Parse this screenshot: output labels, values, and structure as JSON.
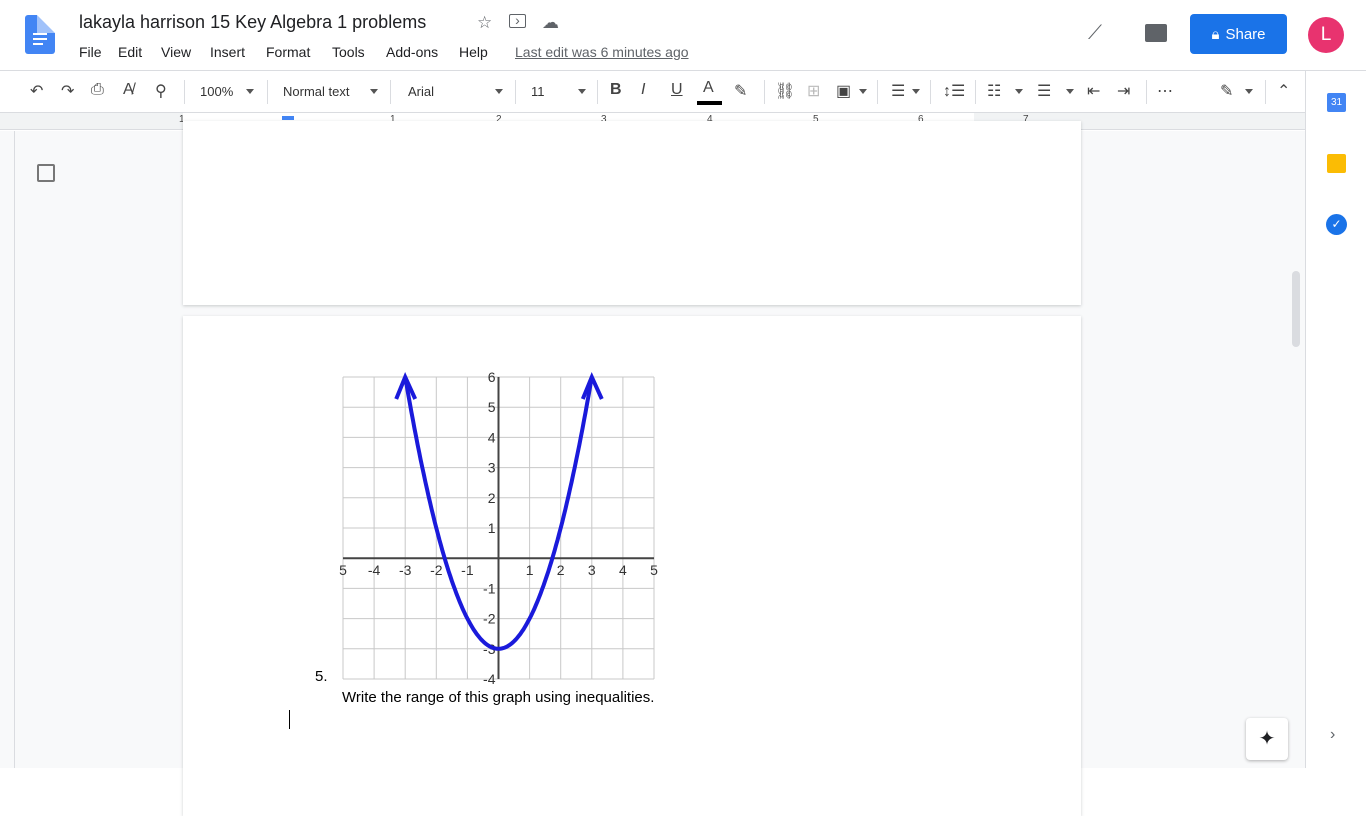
{
  "header": {
    "title": "lakayla harrison 15 Key Algebra 1 problems",
    "last_edit": "Last edit was 6 minutes ago",
    "share_label": "Share",
    "avatar_letter": "L"
  },
  "menu": [
    "File",
    "Edit",
    "View",
    "Insert",
    "Format",
    "Tools",
    "Add-ons",
    "Help"
  ],
  "toolbar": {
    "zoom": "100%",
    "style": "Normal text",
    "font": "Arial",
    "size": "11",
    "text_color": "#000000"
  },
  "ruler": {
    "labels": [
      "1",
      "1",
      "2",
      "3",
      "4",
      "5",
      "6",
      "7"
    ]
  },
  "document": {
    "list_number": "5.",
    "question": "Write the range of this graph using inequalities."
  },
  "graph": {
    "x_ticks": [
      "5",
      "-4",
      "-3",
      "-2",
      "-1",
      "1",
      "2",
      "3",
      "4",
      "5"
    ],
    "y_ticks": [
      "6",
      "5",
      "4",
      "3",
      "2",
      "1",
      "-1",
      "-2",
      "-3",
      "-4"
    ],
    "xlim": [
      -5,
      5
    ],
    "ylim": [
      -4,
      6
    ],
    "curve": "y = x^2 - 3",
    "curve_color": "#1a1adb"
  },
  "colors": {
    "accent": "#1a73e8",
    "avatar": "#e8336f"
  }
}
